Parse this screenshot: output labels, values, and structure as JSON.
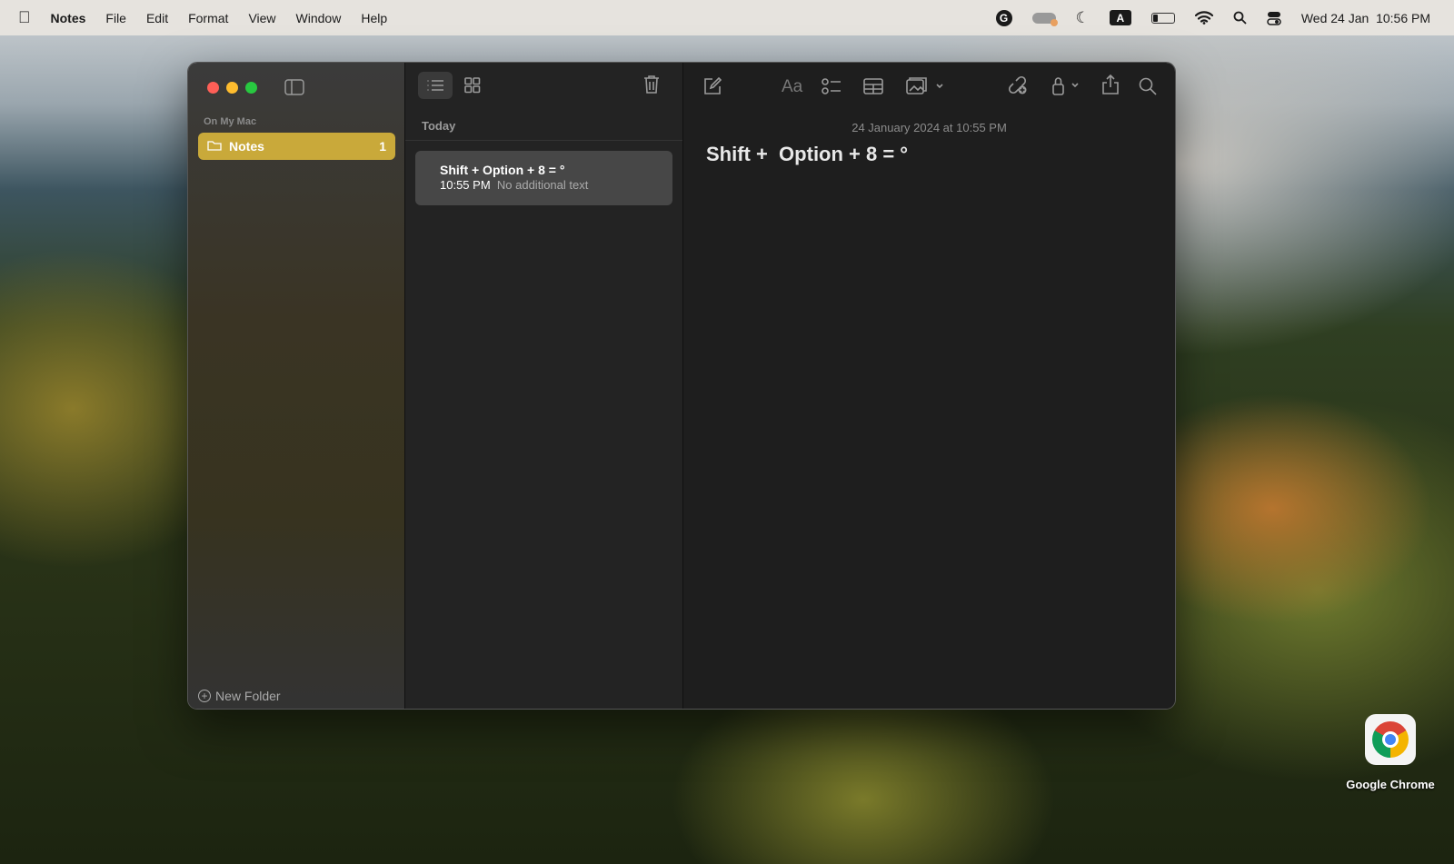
{
  "menubar": {
    "app": "Notes",
    "items": [
      "File",
      "Edit",
      "Format",
      "View",
      "Window",
      "Help"
    ],
    "clock": "Wed 24 Jan  10:56 PM",
    "input_source": "A"
  },
  "sidebar": {
    "section": "On My Mac",
    "folder": {
      "label": "Notes",
      "count": "1"
    },
    "new_folder": "New Folder",
    "accent": "#c9a93a"
  },
  "list": {
    "group": "Today",
    "notes": [
      {
        "title": "Shift + Option + 8 = °",
        "time": "10:55 PM",
        "preview": "No additional text"
      }
    ]
  },
  "editor": {
    "date": "24 January 2024 at 10:55 PM",
    "title": "Shift +  Option + 8 = °",
    "format_label": "Aa"
  },
  "desktop": {
    "icons": [
      {
        "label": "Google Chrome"
      }
    ]
  }
}
